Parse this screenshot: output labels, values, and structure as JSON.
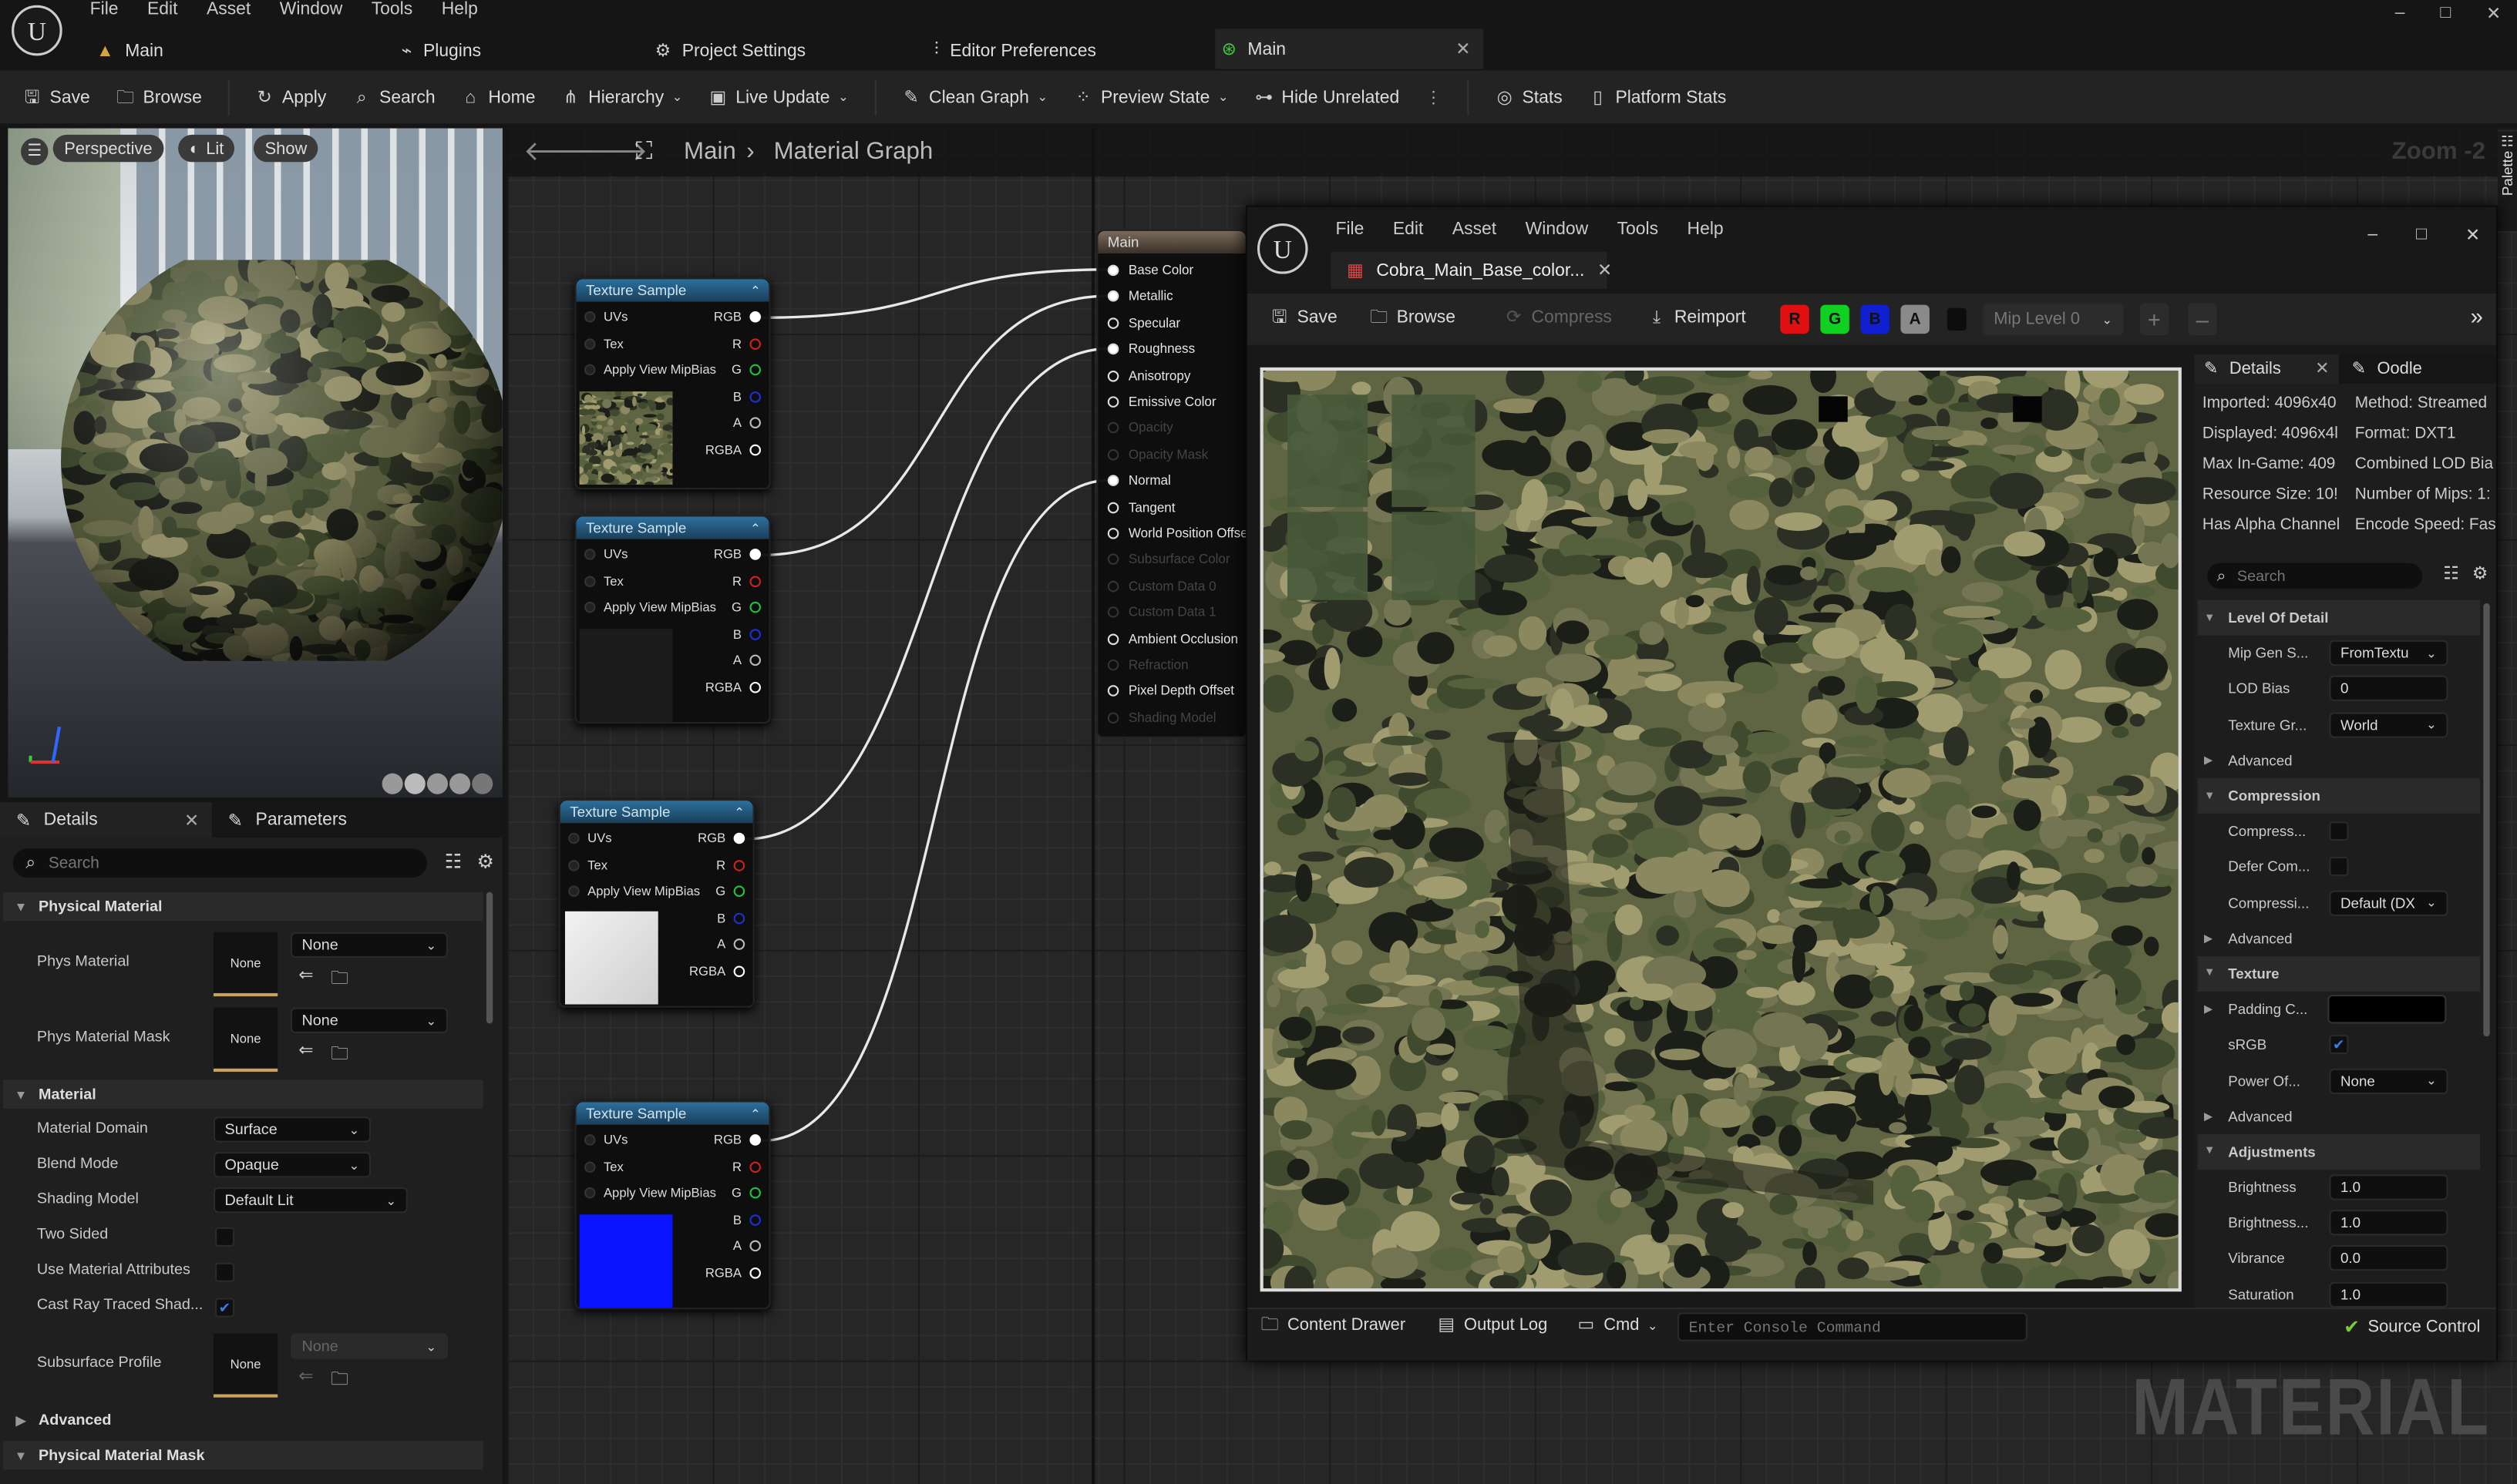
{
  "app": {
    "menu": [
      "File",
      "Edit",
      "Asset",
      "Window",
      "Tools",
      "Help"
    ],
    "tabs": [
      {
        "label": "Main",
        "icon": "material-icon"
      },
      {
        "label": "Plugins",
        "icon": "plug-icon"
      },
      {
        "label": "Project Settings",
        "icon": "settings-icon"
      },
      {
        "label": "Editor Preferences",
        "icon": "sliders-icon"
      },
      {
        "label": "Main",
        "icon": "material-instance-icon",
        "active": true
      }
    ],
    "window_controls": [
      "–",
      "□",
      "✕"
    ],
    "toolbar": [
      {
        "label": "Save",
        "icon": "save-icon"
      },
      {
        "label": "Browse",
        "icon": "browse-icon"
      },
      {
        "label": "Apply",
        "icon": "apply-icon"
      },
      {
        "label": "Search",
        "icon": "search-icon"
      },
      {
        "label": "Home",
        "icon": "home-icon"
      },
      {
        "label": "Hierarchy",
        "icon": "hierarchy-icon",
        "dropdown": true
      },
      {
        "label": "Live Update",
        "icon": "live-update-icon",
        "dropdown": true
      },
      {
        "label": "Clean Graph",
        "icon": "clean-graph-icon",
        "dropdown": true
      },
      {
        "label": "Preview State",
        "icon": "preview-state-icon",
        "dropdown": true
      },
      {
        "label": "Hide Unrelated",
        "icon": "hide-unrelated-icon"
      },
      {
        "label": "Stats",
        "icon": "stats-icon"
      },
      {
        "label": "Platform Stats",
        "icon": "platform-stats-icon"
      }
    ]
  },
  "viewport": {
    "perspective": "Perspective",
    "lit": "Lit",
    "show": "Show"
  },
  "details": {
    "tab_details": "Details",
    "tab_parameters": "Parameters",
    "search_placeholder": "Search",
    "sections": {
      "physical_material": "Physical Material",
      "material": "Material",
      "advanced": "Advanced",
      "physical_material_mask": "Physical Material Mask"
    },
    "phys_material": {
      "label": "Phys Material",
      "thumb": "None",
      "value": "None"
    },
    "phys_material_mask": {
      "label": "Phys Material Mask",
      "thumb": "None",
      "value": "None"
    },
    "material_domain": {
      "label": "Material Domain",
      "value": "Surface"
    },
    "blend_mode": {
      "label": "Blend Mode",
      "value": "Opaque"
    },
    "shading_model": {
      "label": "Shading Model",
      "value": "Default Lit"
    },
    "two_sided": {
      "label": "Two Sided",
      "checked": false
    },
    "use_material_attributes": {
      "label": "Use Material Attributes",
      "checked": false
    },
    "cast_ray_traced_shadows": {
      "label": "Cast Ray Traced Shad...",
      "checked": true
    },
    "subsurface_profile": {
      "label": "Subsurface Profile",
      "thumb": "None",
      "value": "None"
    }
  },
  "graph": {
    "breadcrumb": [
      "Main",
      "Material Graph"
    ],
    "zoom": "Zoom -2",
    "watermark": "MATERIAL",
    "palette": "Palette",
    "texture_nodes": [
      {
        "title": "Texture Sample",
        "inputs": [
          "UVs",
          "Tex",
          "Apply View MipBias"
        ],
        "outputs": [
          "RGB",
          "R",
          "G",
          "B",
          "A",
          "RGBA"
        ],
        "preview": "camo"
      },
      {
        "title": "Texture Sample",
        "inputs": [
          "UVs",
          "Tex",
          "Apply View MipBias"
        ],
        "outputs": [
          "RGB",
          "R",
          "G",
          "B",
          "A",
          "RGBA"
        ],
        "preview": "dark"
      },
      {
        "title": "Texture Sample",
        "inputs": [
          "UVs",
          "Tex",
          "Apply View MipBias"
        ],
        "outputs": [
          "RGB",
          "R",
          "G",
          "B",
          "A",
          "RGBA"
        ],
        "preview": "white"
      },
      {
        "title": "Texture Sample",
        "inputs": [
          "UVs",
          "Tex",
          "Apply View MipBias"
        ],
        "outputs": [
          "RGB",
          "R",
          "G",
          "B",
          "A",
          "RGBA"
        ],
        "preview": "blue"
      }
    ],
    "output_colors": [
      "#ffffff",
      "#d02020",
      "#20c040",
      "#2030d0",
      "#bbbbbb",
      "#ffffff"
    ],
    "main_node": {
      "title": "Main",
      "pins": [
        {
          "label": "Base Color",
          "connected": true
        },
        {
          "label": "Metallic",
          "connected": true
        },
        {
          "label": "Specular"
        },
        {
          "label": "Roughness",
          "connected": true
        },
        {
          "label": "Anisotropy"
        },
        {
          "label": "Emissive Color"
        },
        {
          "label": "Opacity",
          "disabled": true
        },
        {
          "label": "Opacity Mask",
          "disabled": true
        },
        {
          "label": "Normal",
          "connected": true
        },
        {
          "label": "Tangent"
        },
        {
          "label": "World Position Offset"
        },
        {
          "label": "Subsurface Color",
          "disabled": true
        },
        {
          "label": "Custom Data 0",
          "disabled": true
        },
        {
          "label": "Custom Data 1",
          "disabled": true
        },
        {
          "label": "Ambient Occlusion"
        },
        {
          "label": "Refraction",
          "disabled": true
        },
        {
          "label": "Pixel Depth Offset"
        },
        {
          "label": "Shading Model",
          "disabled": true
        }
      ]
    }
  },
  "texture_editor": {
    "menu": [
      "File",
      "Edit",
      "Asset",
      "Window",
      "Tools",
      "Help"
    ],
    "tab": "Cobra_Main_Base_color...",
    "toolbar": {
      "save": "Save",
      "browse": "Browse",
      "compress": "Compress",
      "reimport": "Reimport",
      "channels": [
        "R",
        "G",
        "B",
        "A"
      ],
      "mip": "Mip Level 0"
    },
    "channel_colors": [
      "#e01010",
      "#10d020",
      "#1020d0",
      "#8a8a8a"
    ],
    "details_tab": "Details",
    "oodle_tab": "Oodle",
    "search_placeholder": "Search",
    "info_left": [
      "Imported: 4096x40",
      "Displayed: 4096x4l",
      "Max In-Game: 409",
      "Resource Size: 10!",
      "Has Alpha Channel"
    ],
    "info_right": [
      "Method: Streamed",
      "Format: DXT1",
      "Combined LOD Bia",
      "Number of Mips: 1:",
      "Encode Speed: Fas"
    ],
    "rows": [
      {
        "type": "section",
        "label": "Level Of Detail"
      },
      {
        "label": "Mip Gen S...",
        "dropdown": "FromTextu"
      },
      {
        "label": "LOD Bias",
        "input": "0"
      },
      {
        "label": "Texture Gr...",
        "dropdown": "World"
      },
      {
        "type": "collapsed",
        "label": "Advanced"
      },
      {
        "type": "section",
        "label": "Compression"
      },
      {
        "label": "Compress...",
        "checkbox": false
      },
      {
        "label": "Defer Com...",
        "checkbox": false
      },
      {
        "label": "Compressi...",
        "dropdown": "Default (DX"
      },
      {
        "type": "collapsed",
        "label": "Advanced"
      },
      {
        "type": "section",
        "label": "Texture"
      },
      {
        "label": "Padding C...",
        "color": "#000000",
        "expandable": true
      },
      {
        "label": "sRGB",
        "checkbox": true
      },
      {
        "label": "Power Of...",
        "dropdown": "None"
      },
      {
        "type": "collapsed",
        "label": "Advanced"
      },
      {
        "type": "section",
        "label": "Adjustments"
      },
      {
        "label": "Brightness",
        "input": "1.0"
      },
      {
        "label": "Brightness...",
        "input": "1.0"
      },
      {
        "label": "Vibrance",
        "input": "0.0"
      },
      {
        "label": "Saturation",
        "input": "1.0"
      }
    ]
  },
  "status_bar": {
    "content_drawer": "Content Drawer",
    "output_log": "Output Log",
    "cmd": "Cmd",
    "console_placeholder": "Enter Console Command",
    "source_control": "Source Control"
  }
}
